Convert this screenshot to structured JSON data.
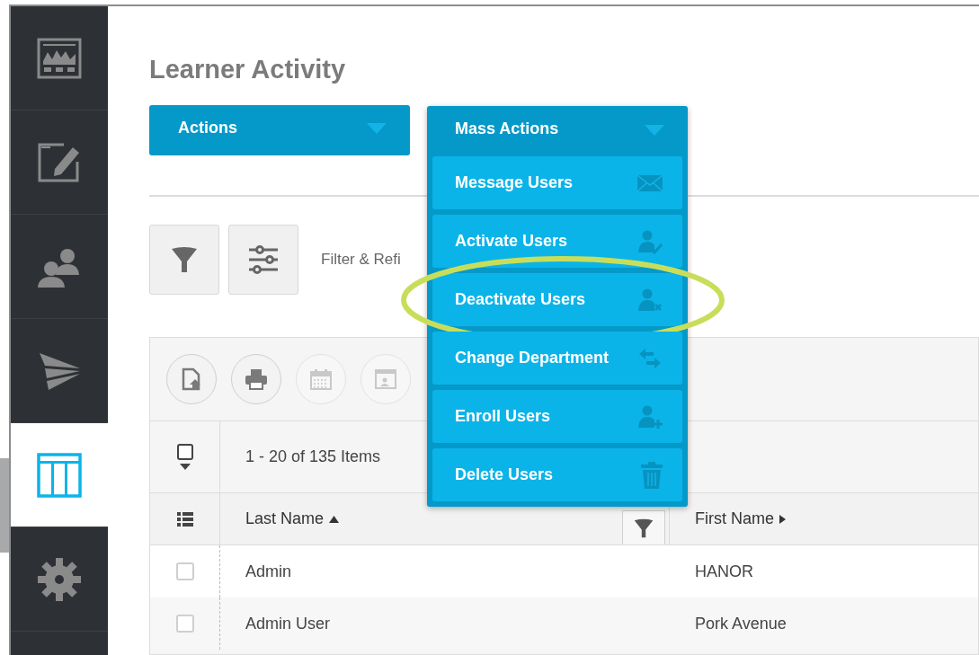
{
  "sidebar": {
    "items": [
      {
        "kind": "dashboard",
        "selected": false
      },
      {
        "kind": "edit",
        "selected": false
      },
      {
        "kind": "users",
        "selected": false
      },
      {
        "kind": "send",
        "selected": false
      },
      {
        "kind": "table",
        "selected": true
      },
      {
        "kind": "gear",
        "selected": false
      }
    ]
  },
  "title": "Learner Activity",
  "actions_button": {
    "label": "Actions"
  },
  "mass_actions": {
    "label": "Mass Actions",
    "items": [
      {
        "label": "Message Users",
        "kind": "mail",
        "circled": false
      },
      {
        "label": "Activate Users",
        "kind": "user-check",
        "circled": false
      },
      {
        "label": "Deactivate Users",
        "kind": "user-x",
        "circled": true
      },
      {
        "label": "Change Department",
        "kind": "swap",
        "circled": false
      },
      {
        "label": "Enroll Users",
        "kind": "user-plus",
        "circled": false
      },
      {
        "label": "Delete Users",
        "kind": "trash",
        "circled": false
      }
    ]
  },
  "filter": {
    "label": "Filter & Refi"
  },
  "table": {
    "toolbar": [
      {
        "kind": "export",
        "disabled": false
      },
      {
        "kind": "print",
        "disabled": false
      },
      {
        "kind": "calendar",
        "disabled": true
      },
      {
        "kind": "card",
        "disabled": true
      }
    ],
    "select_all": {
      "checked": false
    },
    "count": "1 - 20 of 135 Items",
    "columns": [
      {
        "label": "Last Name",
        "sorted": true,
        "filter": true
      },
      {
        "label": "First Name",
        "sorted": false,
        "filter": false
      }
    ],
    "rows": [
      {
        "cells": [
          "Admin",
          "HANOR"
        ],
        "checked": false
      },
      {
        "cells": [
          "Admin User",
          "Pork Avenue"
        ],
        "checked": false
      }
    ]
  }
}
